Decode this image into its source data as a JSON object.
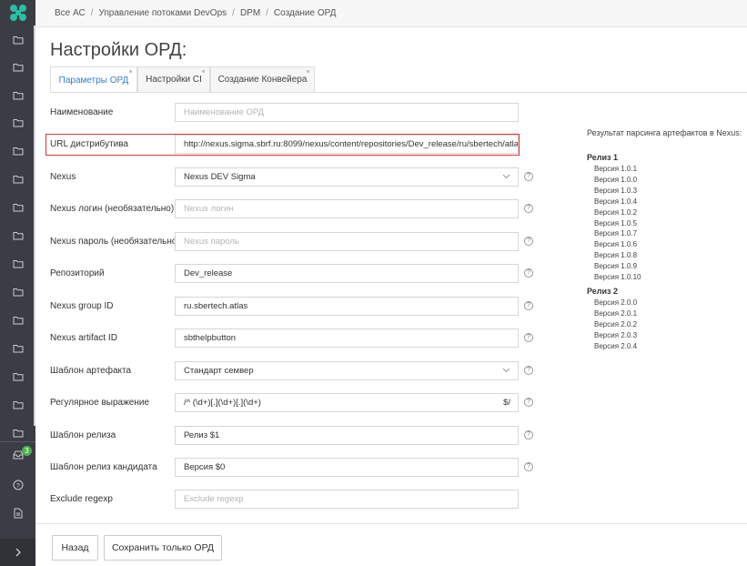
{
  "breadcrumb": {
    "items": [
      "Все АС",
      "Управление потоками DevOps",
      "DPM",
      "Создание ОРД"
    ]
  },
  "page": {
    "title": "Настройки ОРД:"
  },
  "tabs": [
    {
      "label": "Параметры ОРД",
      "active": true
    },
    {
      "label": "Настройки CI",
      "active": false
    },
    {
      "label": "Создание Конвейера",
      "active": false
    }
  ],
  "form": {
    "name": {
      "label": "Наименование",
      "placeholder": "Наименование ОРД"
    },
    "url": {
      "label": "URL дистрибутива",
      "value": "http://nexus.sigma.sbrf.ru:8099/nexus/content/repositories/Dev_release/ru/sbertech/atlas/sbt"
    },
    "nexus": {
      "label": "Nexus",
      "value": "Nexus DEV Sigma"
    },
    "nexus_login": {
      "label": "Nexus логин (необязательно)",
      "placeholder": "Nexus логин"
    },
    "nexus_password": {
      "label": "Nexus пароль (необязательно)",
      "placeholder": "Nexus пароль"
    },
    "repository": {
      "label": "Репозиторий",
      "value": "Dev_release"
    },
    "group_id": {
      "label": "Nexus group ID",
      "value": "ru.sbertech.atlas"
    },
    "artifact_id": {
      "label": "Nexus artifact ID",
      "value": "sbthelpbutton"
    },
    "artifact_template": {
      "label": "Шаблон артефакта",
      "value": "Стандарт семвер"
    },
    "regex": {
      "label": "Регулярное выражение",
      "value": "/^ (\\d+)[.](\\d+)[.](\\d+)",
      "suffix": "$/"
    },
    "release_template": {
      "label": "Шаблон релиза",
      "value": "Релиз $1"
    },
    "candidate_template": {
      "label": "Шаблон релиз кандидата",
      "value": "Версия $0"
    },
    "exclude_regexp": {
      "label": "Exclude regexp",
      "placeholder": "Exclude regexp"
    }
  },
  "help_symbol": "?",
  "parse_result": {
    "title": "Результат парсинга артефактов в Nexus:",
    "releases": [
      {
        "name": "Релиз 1",
        "versions": [
          "Версия 1.0.1",
          "Версия 1.0.0",
          "Версия 1.0.3",
          "Версия 1.0.4",
          "Версия 1.0.2",
          "Версия 1.0.5",
          "Версия 1.0.7",
          "Версия 1.0.6",
          "Версия 1.0.8",
          "Версия 1.0.9",
          "Версия 1.0.10"
        ]
      },
      {
        "name": "Релиз 2",
        "versions": [
          "Версия 2.0.0",
          "Версия 2.0.1",
          "Версия 2.0.2",
          "Версия 2.0.3",
          "Версия 2.0.4"
        ]
      }
    ]
  },
  "buttons": {
    "back": "Назад",
    "save_ord": "Сохранить только ОРД"
  },
  "sidebar": {
    "badge_count": "3"
  },
  "colors": {
    "sidebar": "#3a3d44",
    "accent": "#3b7dc4",
    "highlight": "#d9363e",
    "badge": "#4caf50",
    "logo": "#2bbfa4"
  },
  "icons": [
    "logo-icon",
    "folder-icon",
    "inbox-icon",
    "help-icon",
    "document-icon",
    "chevron-right-icon",
    "chevron-down-icon"
  ]
}
